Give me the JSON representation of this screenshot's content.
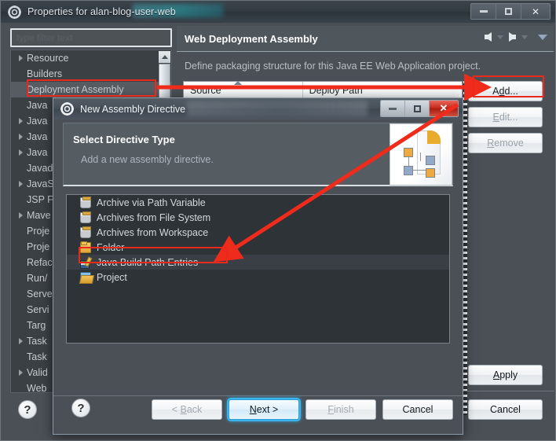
{
  "main_window": {
    "title": "Properties for alan-blog-user-web",
    "icon": "gear-icon",
    "controls": {
      "minimize": "–",
      "maximize": "□",
      "close": "✕"
    }
  },
  "filter": {
    "placeholder": "type filter text",
    "value": ""
  },
  "tree": {
    "items": [
      {
        "label": "Resource",
        "expandable": true,
        "selected": false
      },
      {
        "label": "Builders",
        "expandable": false,
        "selected": false
      },
      {
        "label": "Deployment Assembly",
        "expandable": false,
        "selected": true
      },
      {
        "label": "Java",
        "expandable": false,
        "selected": false
      },
      {
        "label": "Java",
        "expandable": true,
        "selected": false
      },
      {
        "label": "Java",
        "expandable": true,
        "selected": false
      },
      {
        "label": "Java",
        "expandable": true,
        "selected": false
      },
      {
        "label": "Javad",
        "expandable": false,
        "selected": false
      },
      {
        "label": "JavaS",
        "expandable": true,
        "selected": false
      },
      {
        "label": "JSP F",
        "expandable": false,
        "selected": false
      },
      {
        "label": "Mave",
        "expandable": true,
        "selected": false
      },
      {
        "label": "Proje",
        "expandable": false,
        "selected": false
      },
      {
        "label": "Proje",
        "expandable": false,
        "selected": false
      },
      {
        "label": "Refac",
        "expandable": false,
        "selected": false
      },
      {
        "label": "Run/",
        "expandable": false,
        "selected": false
      },
      {
        "label": "Serve",
        "expandable": false,
        "selected": false
      },
      {
        "label": "Servi",
        "expandable": false,
        "selected": false
      },
      {
        "label": "Targ",
        "expandable": false,
        "selected": false
      },
      {
        "label": "Task",
        "expandable": true,
        "selected": false
      },
      {
        "label": "Task",
        "expandable": false,
        "selected": false
      },
      {
        "label": "Valid",
        "expandable": true,
        "selected": false
      },
      {
        "label": "Web",
        "expandable": false,
        "selected": false
      }
    ]
  },
  "page": {
    "title": "Web Deployment Assembly",
    "description": "Define packaging structure for this Java EE Web Application project.",
    "table": {
      "columns": [
        "Source",
        "Deploy Path"
      ],
      "rows": []
    },
    "buttons": {
      "add": "Add...",
      "edit": "Edit...",
      "remove": "Remove",
      "apply": "Apply",
      "cancel": "Cancel"
    },
    "help_icon": "question-mark-icon"
  },
  "dialog": {
    "title": "New Assembly Directive",
    "icon": "gear-icon",
    "controls": {
      "minimize": "–",
      "maximize": "□",
      "close": "✕"
    },
    "banner": {
      "heading": "Select Directive Type",
      "subtext": "Add a new assembly directive.",
      "image": "assembly-wizard-banner-icon"
    },
    "list": [
      {
        "label": "Archive via Path Variable",
        "icon": "jar-icon",
        "selected": false
      },
      {
        "label": "Archives from File System",
        "icon": "jar-icon",
        "selected": false
      },
      {
        "label": "Archives from Workspace",
        "icon": "jar-icon",
        "selected": false
      },
      {
        "label": "Folder",
        "icon": "folder-icon",
        "selected": false
      },
      {
        "label": "Java Build Path Entries",
        "icon": "java-build-path-icon",
        "selected": true
      },
      {
        "label": "Project",
        "icon": "project-icon",
        "selected": false
      }
    ],
    "footer": {
      "help_icon": "question-mark-icon",
      "back": "< Back",
      "next": "Next >",
      "finish": "Finish",
      "cancel": "Cancel"
    }
  },
  "annotations": {
    "color": "#e8291c",
    "highlights": [
      "Deployment Assembly",
      "Add...",
      "Java Build Path Entries"
    ],
    "arrows": 3
  }
}
